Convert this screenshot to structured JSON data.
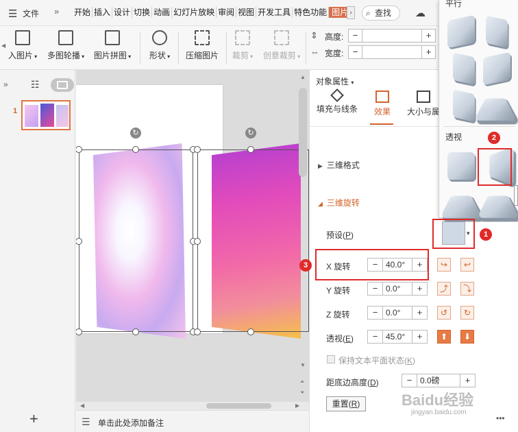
{
  "menubar": {
    "file_label": "文件",
    "tabs": [
      "开始",
      "插入",
      "设计",
      "切换",
      "动画",
      "幻灯片放映",
      "审阅",
      "视图",
      "开发工具",
      "特色功能",
      "图片"
    ],
    "search_label": "查找"
  },
  "ribbon": {
    "insert_picture": "入图片",
    "multi_carousel": "多图轮播",
    "picture_collage": "图片拼图",
    "shape": "形状",
    "compress_picture": "压缩图片",
    "crop": "裁剪",
    "creative_crop": "创意裁剪",
    "height_label": "高度:",
    "width_label": "宽度:"
  },
  "notes": {
    "placeholder": "单击此处添加备注"
  },
  "panel": {
    "title": "对象属性",
    "tabs": [
      "填充与线条",
      "效果",
      "大小与属"
    ],
    "sections": {
      "format_3d": "三维格式",
      "rotation_3d": "三维旋转"
    },
    "preset_label": "预设(",
    "preset_key": "P",
    "x_label": "X 旋转",
    "x_value": "40.0°",
    "y_label": "Y 旋转",
    "y_value": "0.0°",
    "z_label": "Z 旋转",
    "z_value": "0.0°",
    "persp_label": "透视(",
    "persp_key": "E",
    "persp_value": "45.0°",
    "keep_flat": "保持文本平面状态(",
    "keep_flat_key": "K",
    "distance_label": "距底边高度(",
    "distance_key": "D",
    "distance_value": "0.0磅",
    "reset": "重置(",
    "reset_key": "R"
  },
  "gallery": {
    "parallel_title": "平行",
    "perspective_title": "透视"
  },
  "annotations": [
    "1",
    "2",
    "3"
  ],
  "slide_number": "1",
  "watermark": "Baidu经验",
  "watermark_url": "jingyan.baidu.com"
}
